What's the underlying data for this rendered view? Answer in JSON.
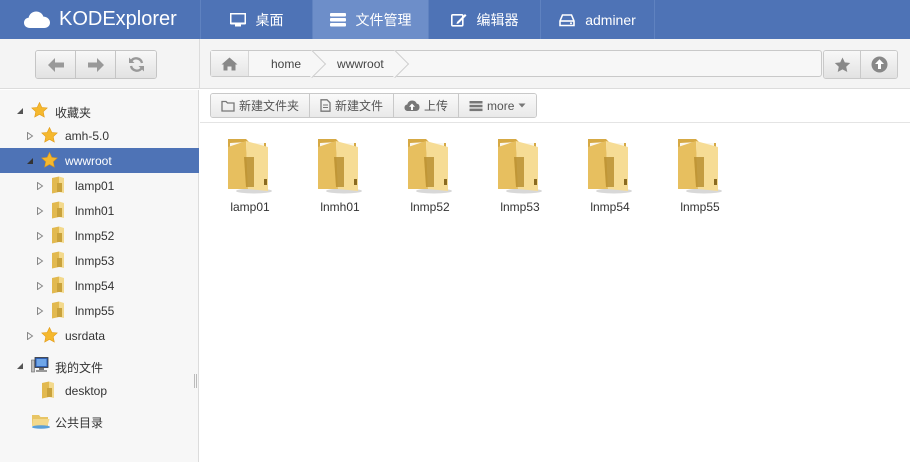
{
  "app": {
    "brand": "KODExplorer"
  },
  "nav": {
    "tabs": [
      {
        "label": "桌面",
        "icon": "monitor-icon"
      },
      {
        "label": "文件管理",
        "icon": "server-icon"
      },
      {
        "label": "编辑器",
        "icon": "edit-icon"
      },
      {
        "label": "adminer",
        "icon": "drive-icon"
      }
    ],
    "active_index": 1
  },
  "breadcrumb": {
    "items": [
      "home",
      "wwwroot"
    ]
  },
  "toolbar": {
    "buttons": [
      {
        "label": "新建文件夹",
        "icon": "folder-outline-icon"
      },
      {
        "label": "新建文件",
        "icon": "file-outline-icon"
      },
      {
        "label": "上传",
        "icon": "cloud-upload-icon"
      },
      {
        "label": "more",
        "icon": "hdd-icon"
      }
    ]
  },
  "sidebar": {
    "favorites_label": "收藏夹",
    "fav_items": [
      "amh-5.0",
      "wwwroot"
    ],
    "wwwroot_children": [
      "lamp01",
      "lnmh01",
      "lnmp52",
      "lnmp53",
      "lnmp54",
      "lnmp55"
    ],
    "usrdata_label": "usrdata",
    "my_files_label": "我的文件",
    "desktop_label": "desktop",
    "public_label": "公共目录",
    "selected": "wwwroot"
  },
  "files": [
    "lamp01",
    "lnmh01",
    "lnmp52",
    "lnmp53",
    "lnmp54",
    "lnmp55"
  ],
  "colors": {
    "topbar": "#4e73b6",
    "active_tab": "#6d8ec9",
    "selection": "#4e73b6",
    "folder": "#e9c97a"
  }
}
